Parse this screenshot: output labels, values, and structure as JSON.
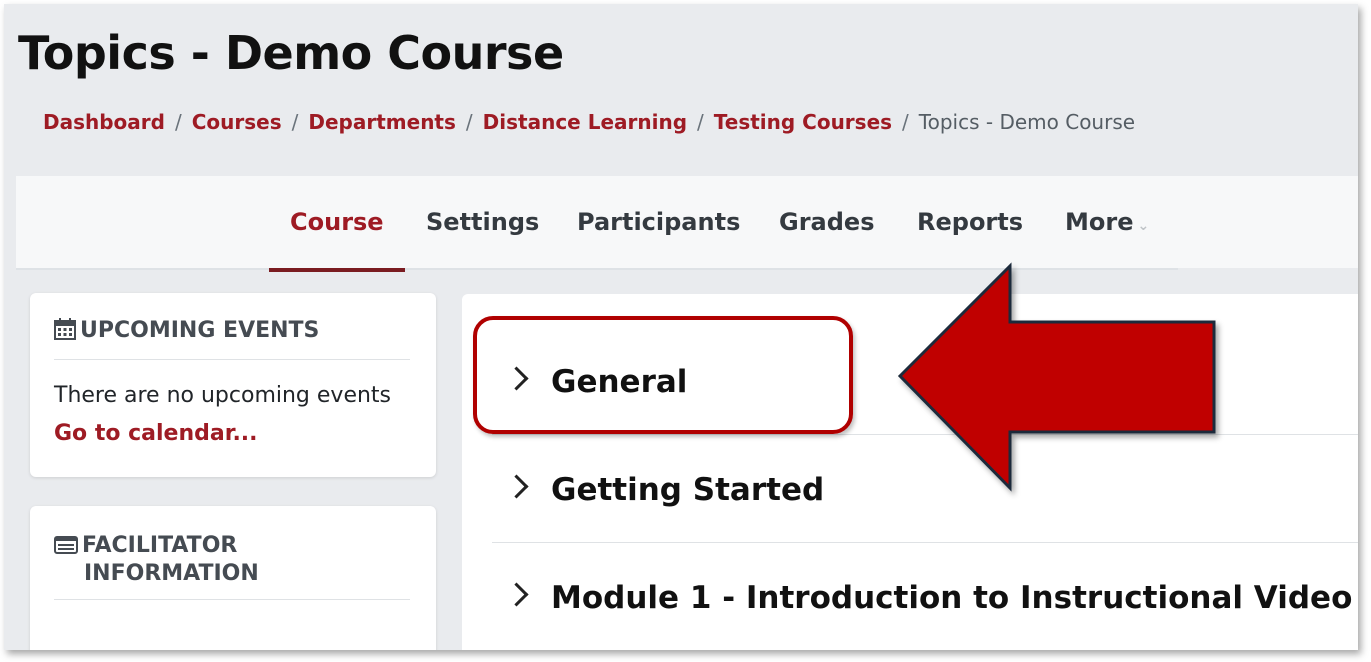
{
  "page": {
    "title": "Topics - Demo Course"
  },
  "breadcrumb": {
    "items": [
      "Dashboard",
      "Courses",
      "Departments",
      "Distance Learning",
      "Testing Courses"
    ],
    "current": "Topics - Demo Course",
    "separator": "/"
  },
  "nav": {
    "tabs": [
      {
        "label": "Course",
        "active": true
      },
      {
        "label": "Settings"
      },
      {
        "label": "Participants"
      },
      {
        "label": "Grades"
      },
      {
        "label": "Reports"
      },
      {
        "label": "More"
      }
    ]
  },
  "upcoming_events": {
    "heading": "UPCOMING EVENTS",
    "icon": "calendar-icon",
    "empty_text": "There are no upcoming events",
    "link": "Go to calendar..."
  },
  "facilitator": {
    "heading_line1": "FACILITATOR",
    "heading_line2": "INFORMATION",
    "icon": "id-card-icon"
  },
  "sections": [
    {
      "title": "General"
    },
    {
      "title": "Getting Started"
    },
    {
      "title": "Module 1 - Introduction to Instructional Video"
    }
  ],
  "colors": {
    "brand": "#9e1b24",
    "annotation_red": "#c00000",
    "annotation_outline": "#1f2b3a"
  }
}
